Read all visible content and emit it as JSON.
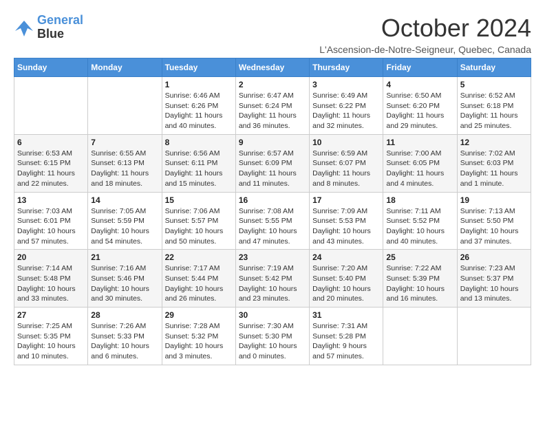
{
  "logo": {
    "line1": "General",
    "line2": "Blue"
  },
  "title": "October 2024",
  "location": "L'Ascension-de-Notre-Seigneur, Quebec, Canada",
  "weekdays": [
    "Sunday",
    "Monday",
    "Tuesday",
    "Wednesday",
    "Thursday",
    "Friday",
    "Saturday"
  ],
  "weeks": [
    [
      {
        "day": "",
        "detail": ""
      },
      {
        "day": "",
        "detail": ""
      },
      {
        "day": "1",
        "detail": "Sunrise: 6:46 AM\nSunset: 6:26 PM\nDaylight: 11 hours and 40 minutes."
      },
      {
        "day": "2",
        "detail": "Sunrise: 6:47 AM\nSunset: 6:24 PM\nDaylight: 11 hours and 36 minutes."
      },
      {
        "day": "3",
        "detail": "Sunrise: 6:49 AM\nSunset: 6:22 PM\nDaylight: 11 hours and 32 minutes."
      },
      {
        "day": "4",
        "detail": "Sunrise: 6:50 AM\nSunset: 6:20 PM\nDaylight: 11 hours and 29 minutes."
      },
      {
        "day": "5",
        "detail": "Sunrise: 6:52 AM\nSunset: 6:18 PM\nDaylight: 11 hours and 25 minutes."
      }
    ],
    [
      {
        "day": "6",
        "detail": "Sunrise: 6:53 AM\nSunset: 6:15 PM\nDaylight: 11 hours and 22 minutes."
      },
      {
        "day": "7",
        "detail": "Sunrise: 6:55 AM\nSunset: 6:13 PM\nDaylight: 11 hours and 18 minutes."
      },
      {
        "day": "8",
        "detail": "Sunrise: 6:56 AM\nSunset: 6:11 PM\nDaylight: 11 hours and 15 minutes."
      },
      {
        "day": "9",
        "detail": "Sunrise: 6:57 AM\nSunset: 6:09 PM\nDaylight: 11 hours and 11 minutes."
      },
      {
        "day": "10",
        "detail": "Sunrise: 6:59 AM\nSunset: 6:07 PM\nDaylight: 11 hours and 8 minutes."
      },
      {
        "day": "11",
        "detail": "Sunrise: 7:00 AM\nSunset: 6:05 PM\nDaylight: 11 hours and 4 minutes."
      },
      {
        "day": "12",
        "detail": "Sunrise: 7:02 AM\nSunset: 6:03 PM\nDaylight: 11 hours and 1 minute."
      }
    ],
    [
      {
        "day": "13",
        "detail": "Sunrise: 7:03 AM\nSunset: 6:01 PM\nDaylight: 10 hours and 57 minutes."
      },
      {
        "day": "14",
        "detail": "Sunrise: 7:05 AM\nSunset: 5:59 PM\nDaylight: 10 hours and 54 minutes."
      },
      {
        "day": "15",
        "detail": "Sunrise: 7:06 AM\nSunset: 5:57 PM\nDaylight: 10 hours and 50 minutes."
      },
      {
        "day": "16",
        "detail": "Sunrise: 7:08 AM\nSunset: 5:55 PM\nDaylight: 10 hours and 47 minutes."
      },
      {
        "day": "17",
        "detail": "Sunrise: 7:09 AM\nSunset: 5:53 PM\nDaylight: 10 hours and 43 minutes."
      },
      {
        "day": "18",
        "detail": "Sunrise: 7:11 AM\nSunset: 5:52 PM\nDaylight: 10 hours and 40 minutes."
      },
      {
        "day": "19",
        "detail": "Sunrise: 7:13 AM\nSunset: 5:50 PM\nDaylight: 10 hours and 37 minutes."
      }
    ],
    [
      {
        "day": "20",
        "detail": "Sunrise: 7:14 AM\nSunset: 5:48 PM\nDaylight: 10 hours and 33 minutes."
      },
      {
        "day": "21",
        "detail": "Sunrise: 7:16 AM\nSunset: 5:46 PM\nDaylight: 10 hours and 30 minutes."
      },
      {
        "day": "22",
        "detail": "Sunrise: 7:17 AM\nSunset: 5:44 PM\nDaylight: 10 hours and 26 minutes."
      },
      {
        "day": "23",
        "detail": "Sunrise: 7:19 AM\nSunset: 5:42 PM\nDaylight: 10 hours and 23 minutes."
      },
      {
        "day": "24",
        "detail": "Sunrise: 7:20 AM\nSunset: 5:40 PM\nDaylight: 10 hours and 20 minutes."
      },
      {
        "day": "25",
        "detail": "Sunrise: 7:22 AM\nSunset: 5:39 PM\nDaylight: 10 hours and 16 minutes."
      },
      {
        "day": "26",
        "detail": "Sunrise: 7:23 AM\nSunset: 5:37 PM\nDaylight: 10 hours and 13 minutes."
      }
    ],
    [
      {
        "day": "27",
        "detail": "Sunrise: 7:25 AM\nSunset: 5:35 PM\nDaylight: 10 hours and 10 minutes."
      },
      {
        "day": "28",
        "detail": "Sunrise: 7:26 AM\nSunset: 5:33 PM\nDaylight: 10 hours and 6 minutes."
      },
      {
        "day": "29",
        "detail": "Sunrise: 7:28 AM\nSunset: 5:32 PM\nDaylight: 10 hours and 3 minutes."
      },
      {
        "day": "30",
        "detail": "Sunrise: 7:30 AM\nSunset: 5:30 PM\nDaylight: 10 hours and 0 minutes."
      },
      {
        "day": "31",
        "detail": "Sunrise: 7:31 AM\nSunset: 5:28 PM\nDaylight: 9 hours and 57 minutes."
      },
      {
        "day": "",
        "detail": ""
      },
      {
        "day": "",
        "detail": ""
      }
    ]
  ]
}
